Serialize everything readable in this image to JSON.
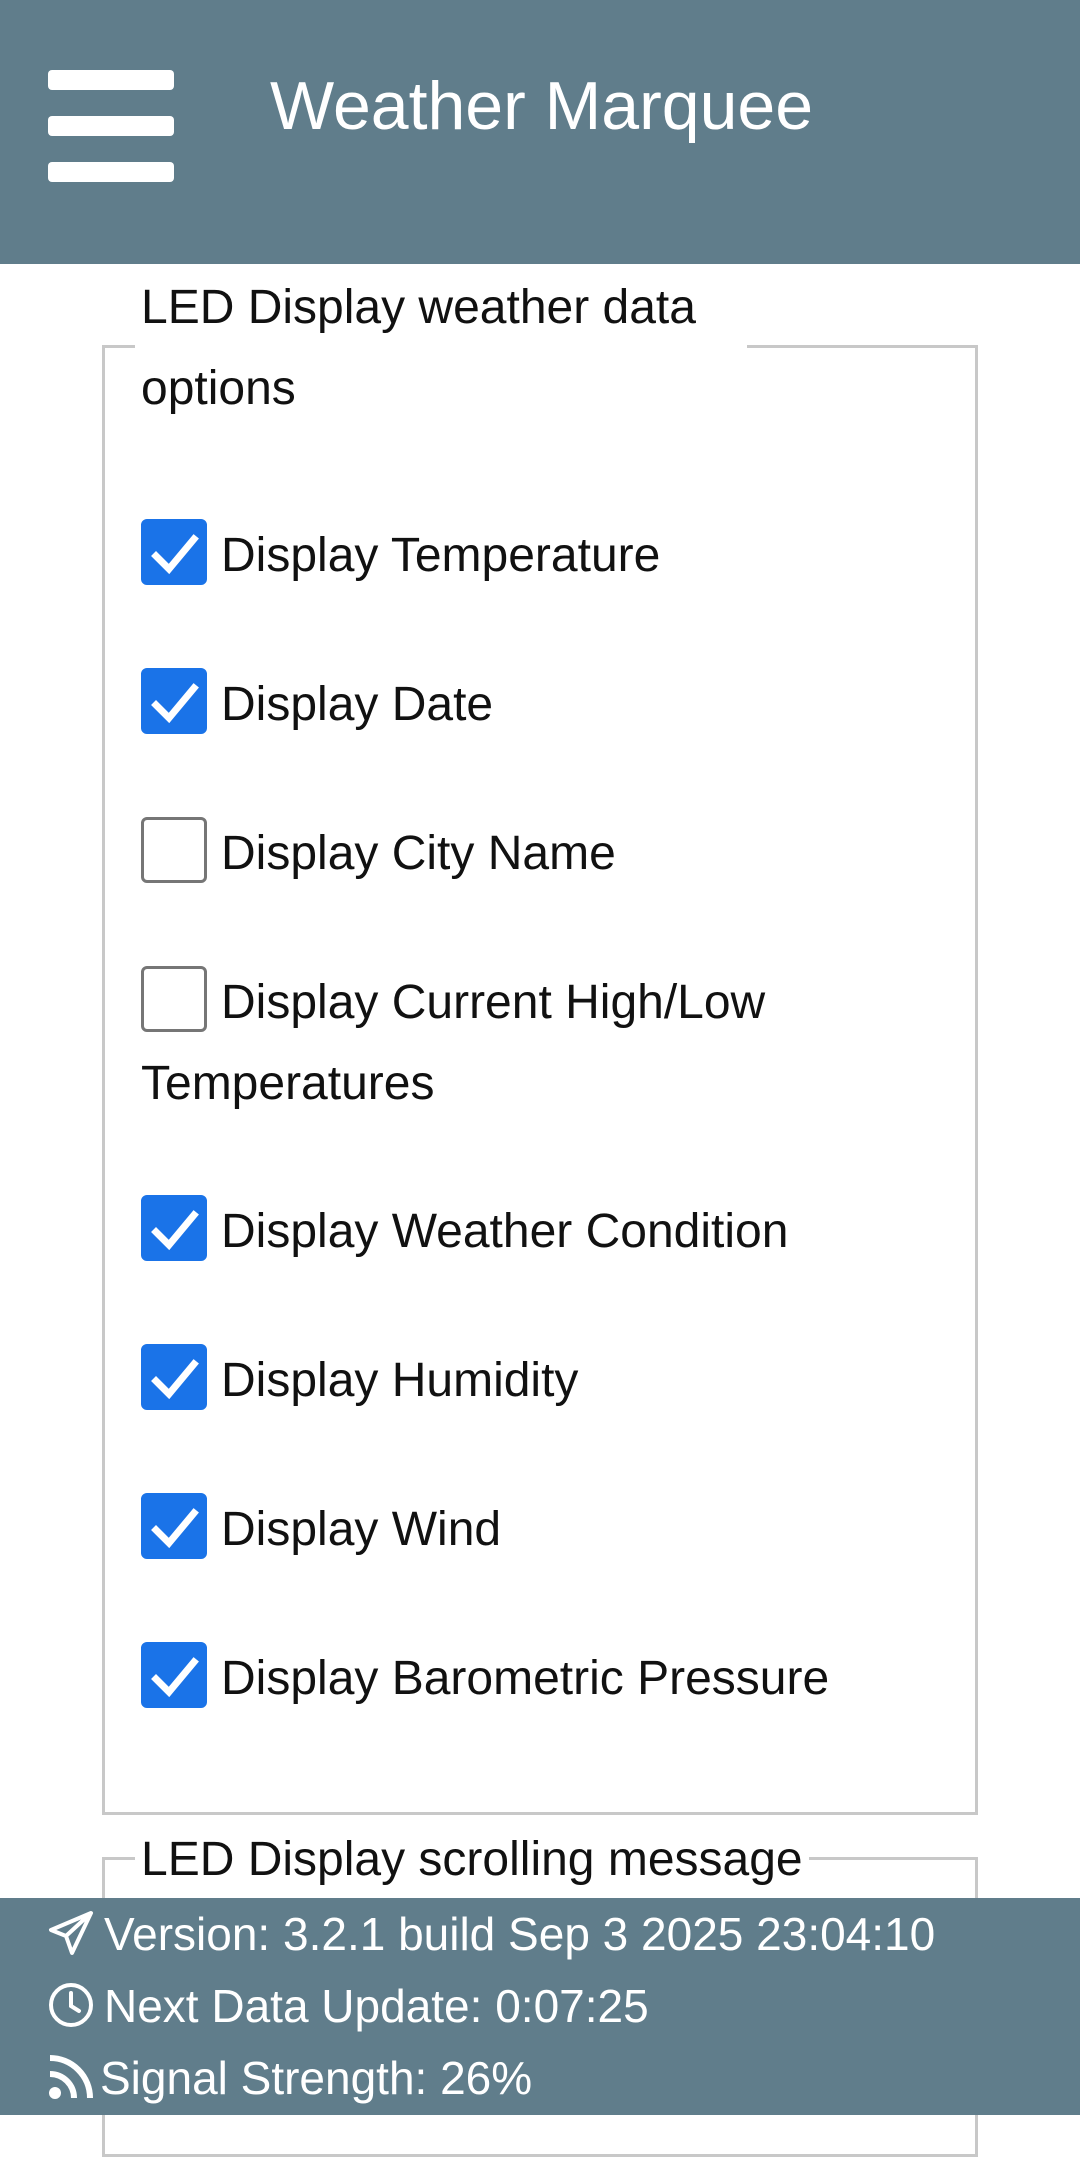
{
  "header": {
    "title": "Weather Marquee",
    "menu_icon": "hamburger-menu-icon"
  },
  "weather_options": {
    "legend": "LED Display weather data options",
    "items": [
      {
        "label": "Display Temperature",
        "checked": true
      },
      {
        "label": "Display Date",
        "checked": true
      },
      {
        "label": "Display City Name",
        "checked": false
      },
      {
        "label": "Display Current High/Low Temperatures",
        "checked": false
      },
      {
        "label": "Display Weather Condition",
        "checked": true
      },
      {
        "label": "Display Humidity",
        "checked": true
      },
      {
        "label": "Display Wind",
        "checked": true
      },
      {
        "label": "Display Barometric Pressure",
        "checked": true
      }
    ]
  },
  "scrolling_message": {
    "legend": "LED Display scrolling message"
  },
  "footer": {
    "version": "Version: 3.2.1 build Sep 3 2025 23:04:10",
    "next_update": "Next Data Update: 0:07:25",
    "signal": "Signal Strength: 26%",
    "version_icon": "paper-plane-icon",
    "next_update_icon": "clock-icon",
    "signal_icon": "rss-signal-icon"
  },
  "colors": {
    "header_bg": "#607d8b",
    "checkbox_accent": "#1a73e8"
  }
}
